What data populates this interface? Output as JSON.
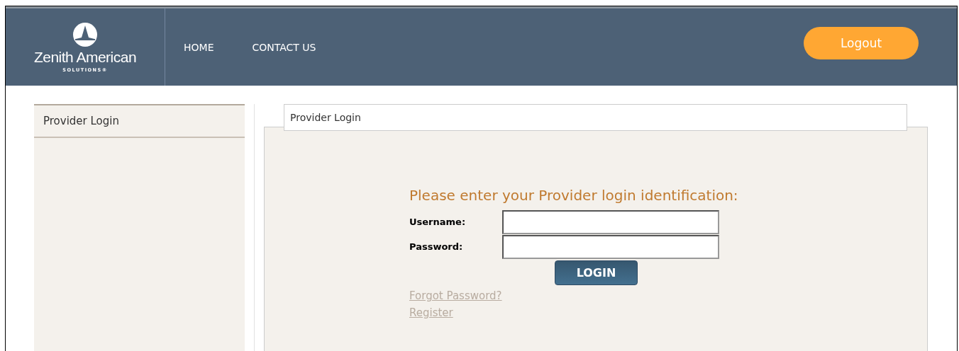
{
  "header": {
    "logo": {
      "name": "Zenith American",
      "tagline": "SOLUTIONS®"
    },
    "nav": [
      {
        "label": "HOME"
      },
      {
        "label": "CONTACT US"
      }
    ],
    "logout": "Logout"
  },
  "sidebar": {
    "items": [
      {
        "label": "Provider Login"
      }
    ]
  },
  "main": {
    "title": "Provider Login",
    "heading": "Please enter your Provider login identification:",
    "fields": [
      {
        "label": "Username:"
      },
      {
        "label": "Password:"
      }
    ],
    "button": "LOGIN",
    "links": [
      {
        "label": "Forgot Password?"
      },
      {
        "label": "Register"
      }
    ]
  }
}
